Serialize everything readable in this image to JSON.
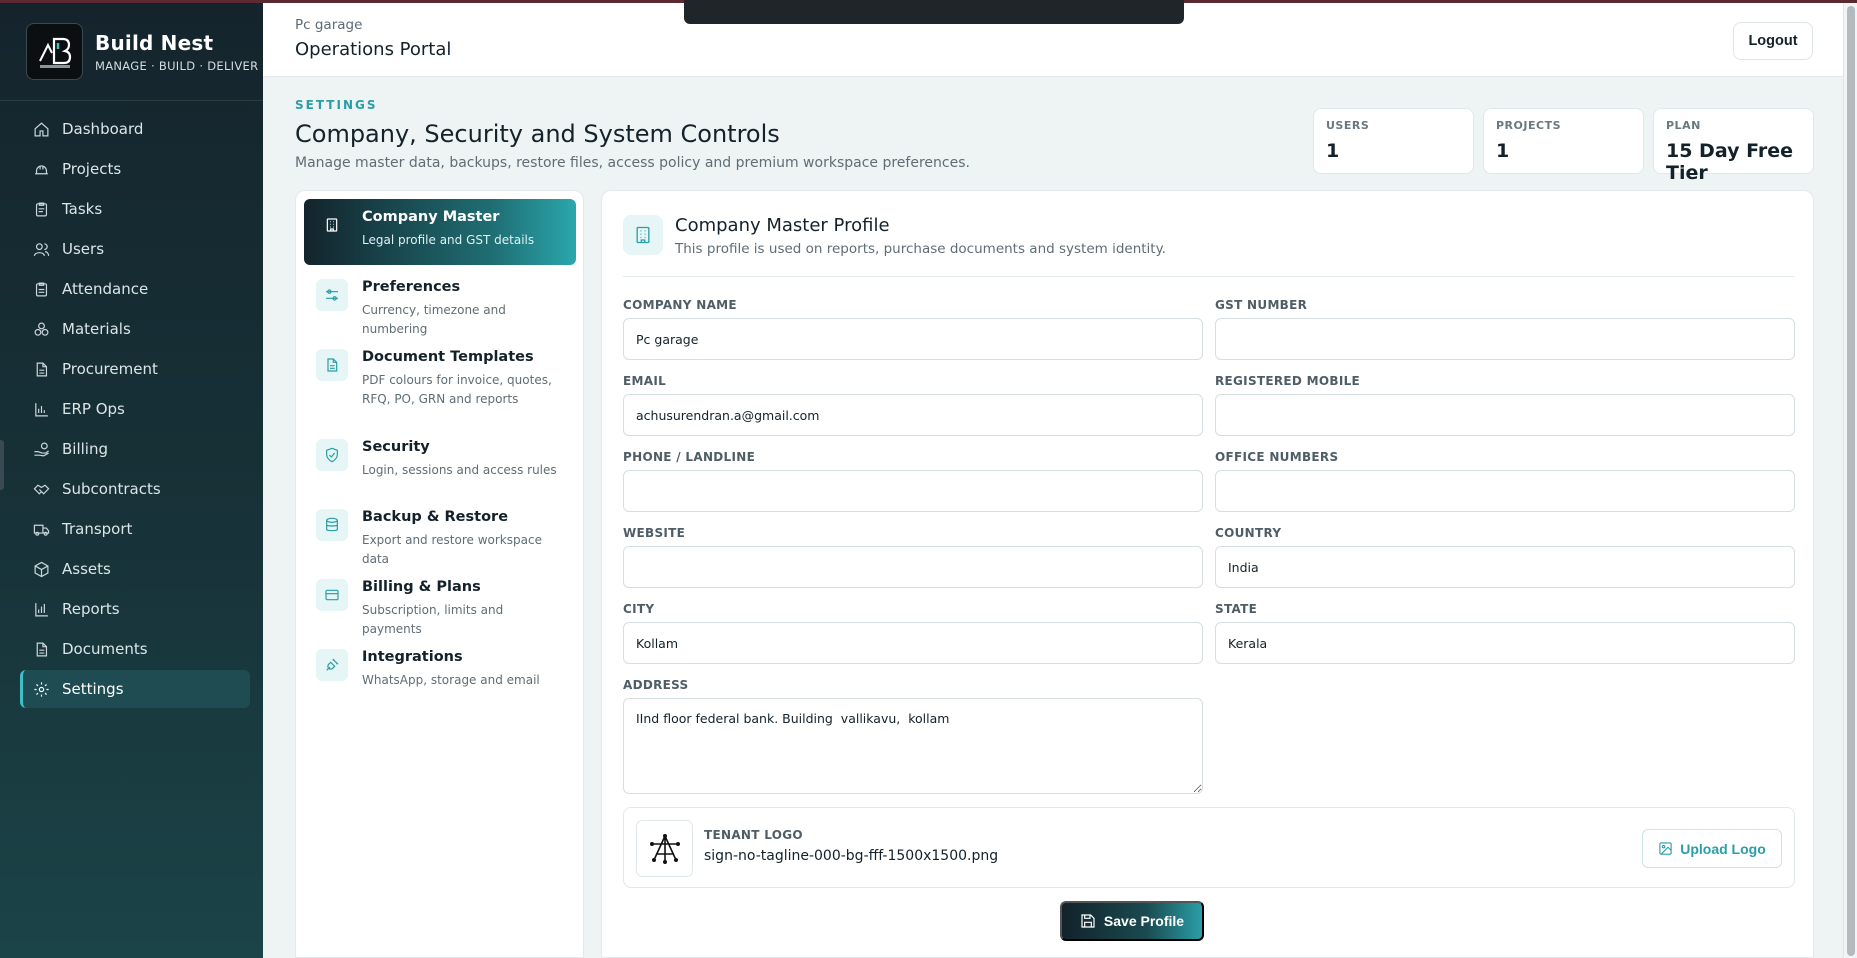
{
  "brand": {
    "name": "Build Nest",
    "tagline": "MANAGE · BUILD · DELIVER",
    "logo_icon": "build-nest-logo"
  },
  "sidebar": {
    "items": [
      {
        "label": "Dashboard",
        "icon": "home-icon"
      },
      {
        "label": "Projects",
        "icon": "hardhat-icon"
      },
      {
        "label": "Tasks",
        "icon": "clipboard-icon"
      },
      {
        "label": "Users",
        "icon": "users-icon"
      },
      {
        "label": "Attendance",
        "icon": "clipboard-check-icon"
      },
      {
        "label": "Materials",
        "icon": "boxes-icon"
      },
      {
        "label": "Procurement",
        "icon": "file-icon"
      },
      {
        "label": "ERP Ops",
        "icon": "bar-chart-icon"
      },
      {
        "label": "Billing",
        "icon": "hand-coins-icon"
      },
      {
        "label": "Subcontracts",
        "icon": "handshake-icon"
      },
      {
        "label": "Transport",
        "icon": "truck-icon"
      },
      {
        "label": "Assets",
        "icon": "package-icon"
      },
      {
        "label": "Reports",
        "icon": "chart-icon"
      },
      {
        "label": "Documents",
        "icon": "document-icon"
      },
      {
        "label": "Settings",
        "icon": "gear-icon",
        "active": true
      }
    ]
  },
  "header": {
    "subtitle": "Pc garage",
    "title": "Operations Portal",
    "logout_label": "Logout"
  },
  "page": {
    "eyebrow": "SETTINGS",
    "title": "Company, Security and System Controls",
    "description": "Manage master data, backups, restore files, access policy and premium workspace preferences."
  },
  "stats": [
    {
      "label": "USERS",
      "value": "1"
    },
    {
      "label": "PROJECTS",
      "value": "1"
    },
    {
      "label": "PLAN",
      "value": "15 Day Free Tier"
    }
  ],
  "settings_menu": [
    {
      "title": "Company Master",
      "subtitle": "Legal profile and GST details",
      "icon": "building-icon",
      "active": true
    },
    {
      "title": "Preferences",
      "subtitle": "Currency, timezone and numbering",
      "icon": "sliders-icon"
    },
    {
      "title": "Document Templates",
      "subtitle": "PDF colours for invoice, quotes, RFQ, PO, GRN and reports",
      "icon": "document-icon"
    },
    {
      "title": "Security",
      "subtitle": "Login, sessions and access rules",
      "icon": "shield-check-icon"
    },
    {
      "title": "Backup & Restore",
      "subtitle": "Export and restore workspace data",
      "icon": "database-icon"
    },
    {
      "title": "Billing & Plans",
      "subtitle": "Subscription, limits and payments",
      "icon": "credit-card-icon"
    },
    {
      "title": "Integrations",
      "subtitle": "WhatsApp, storage and email",
      "icon": "plug-icon"
    }
  ],
  "profile": {
    "title": "Company Master Profile",
    "subtitle": "This profile is used on reports, purchase documents and system identity.",
    "fields": {
      "company_name": {
        "label": "COMPANY NAME",
        "value": "Pc garage"
      },
      "gst_number": {
        "label": "GST NUMBER",
        "value": ""
      },
      "email": {
        "label": "EMAIL",
        "value": "achusurendran.a@gmail.com"
      },
      "registered_mobile": {
        "label": "REGISTERED MOBILE",
        "value": ""
      },
      "phone": {
        "label": "PHONE / LANDLINE",
        "value": ""
      },
      "office_numbers": {
        "label": "OFFICE NUMBERS",
        "value": ""
      },
      "website": {
        "label": "WEBSITE",
        "value": ""
      },
      "country": {
        "label": "COUNTRY",
        "value": "India"
      },
      "city": {
        "label": "CITY",
        "value": "Kollam"
      },
      "state": {
        "label": "STATE",
        "value": "Kerala"
      },
      "address": {
        "label": "ADDRESS",
        "value": "IInd floor federal bank. Building  vallikavu,  kollam"
      }
    },
    "logo": {
      "label": "TENANT LOGO",
      "filename": "sign-no-tagline-000-bg-fff-1500x1500.png",
      "upload_label": "Upload Logo"
    },
    "save_label": "Save Profile"
  },
  "colors": {
    "accent": "#2a9ea6",
    "sidebar_bg": "#15242c",
    "active_nav": "#1e4c52"
  }
}
